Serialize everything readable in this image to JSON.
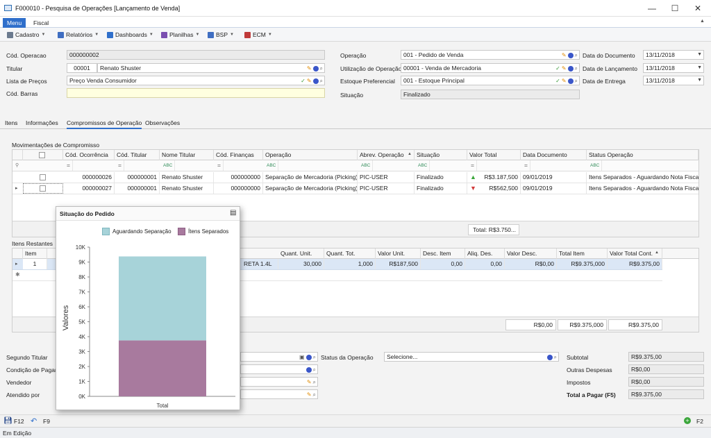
{
  "window": {
    "title": "F000010 - Pesquisa de Operações [Lançamento de Venda]",
    "min": "—",
    "max": "☐",
    "close": "✕"
  },
  "tabs": [
    "Menu",
    "Fiscal"
  ],
  "toolbar": [
    {
      "label": "Cadastro",
      "color": "#6b7a8f"
    },
    {
      "label": "Relatórios",
      "color": "#3f6ec2"
    },
    {
      "label": "Dashboards",
      "color": "#2f6fcb"
    },
    {
      "label": "Planilhas",
      "color": "#7a4fb0"
    },
    {
      "label": "BSP",
      "color": "#3f6ec2"
    },
    {
      "label": "ECM",
      "color": "#c03a3a"
    }
  ],
  "form": {
    "cod_operacao_label": "Cód. Operacao",
    "cod_operacao": "000000002",
    "titular_label": "Titular",
    "titular_code": "00001",
    "titular_name": "Renato Shuster",
    "lista_label": "Lista de Preços",
    "lista": "Preço Venda Consumidor",
    "barras_label": "Cód. Barras",
    "barras": "",
    "operacao_label": "Operação",
    "operacao": "001 - Pedido de Venda",
    "utilizacao_label": "Utilização de Operação",
    "utilizacao": "00001 - Venda de Mercadoria",
    "estoque_label": "Estoque Preferencial",
    "estoque": "001 - Estoque Principal",
    "situacao_label": "Situação",
    "situacao": "Finalizado",
    "data_doc_label": "Data do Documento",
    "data_doc": "13/11/2018",
    "data_lanc_label": "Data de Lançamento",
    "data_lanc": "13/11/2018",
    "data_ent_label": "Data de Entrega",
    "data_ent": "13/11/2018"
  },
  "subtabs": [
    "Itens",
    "Informações",
    "Compromissos de Operação",
    "Observações"
  ],
  "mov": {
    "title": "Movimentações de Compromisso",
    "headers": [
      "Cód. Ocorrência",
      "Cód. Titular",
      "Nome Titular",
      "Cód. Finanças",
      "Operação",
      "Abrev. Operação",
      "Situação",
      "Valor Total",
      "Data Documento",
      "Status Operação"
    ],
    "filters": [
      "=",
      "=",
      "ABC",
      "=",
      "ABC",
      "ABC",
      "ABC",
      "=",
      "=",
      "ABC"
    ],
    "rows": [
      [
        "000000026",
        "000000001",
        "Renato Shuster",
        "000000000",
        "Separação de Mercadoria (Picking)",
        "PIC-USER",
        "Finalizado",
        "R$3.187,500",
        "09/01/2019",
        "Itens Separados - Aguardando Nota Fiscal"
      ],
      [
        "000000027",
        "000000001",
        "Renato Shuster",
        "000000000",
        "Separação de Mercadoria (Picking)",
        "PIC-USER",
        "Finalizado",
        "R$562,500",
        "09/01/2019",
        "Itens Separados - Aguardando Nota Fiscal"
      ]
    ],
    "total": "Total: R$3.750..."
  },
  "itens": {
    "title": "Itens Restantes",
    "headers": [
      "Item",
      "Quant. Unit.",
      "Quant. Tot.",
      "Valor Unit.",
      "Desc. Item",
      "Aliq. Des.",
      "Valor Desc.",
      "Total Item",
      "Valor Total Cont."
    ],
    "row": [
      "1",
      "RETA 1.4L",
      "30,000",
      "1,000",
      "R$187,500",
      "0,00",
      "0,00",
      "R$0,00",
      "R$9.375,000",
      "R$9.375,00"
    ],
    "footer": [
      "R$0,00",
      "R$9.375,000",
      "R$9.375,00"
    ]
  },
  "bottom": {
    "segundo": "Segundo Titular",
    "condicao": "Condição de Pagam",
    "vendedor": "Vendedor",
    "atendido": "Atendido por",
    "status_label": "Status da Operação",
    "status_value": "Selecione...",
    "subtotal_label": "Subtotal",
    "subtotal": "R$9.375,00",
    "outras_label": "Outras Despesas",
    "outras": "R$0,00",
    "impostos_label": "Impostos",
    "impostos": "R$0,00",
    "total_label": "Total a Pagar (F5)",
    "total": "R$9.375,00"
  },
  "actions": {
    "f12": "F12",
    "f9": "F9",
    "f2": "F2"
  },
  "status": "Em Edição",
  "chart_data": {
    "type": "bar",
    "title": "Situação do Pedido",
    "categories": [
      "Total"
    ],
    "series": [
      {
        "name": "Itens Separados",
        "values": [
          3750
        ],
        "color": "#a87a9e"
      },
      {
        "name": "Aguardando Separação",
        "values": [
          5625
        ],
        "color": "#a7d3d9"
      }
    ],
    "legend": [
      "Aguardando Separação",
      "Ítens Separados"
    ],
    "ylabel": "Valores",
    "ylim": [
      0,
      10000
    ],
    "yticks": [
      "0K",
      "1K",
      "2K",
      "3K",
      "4K",
      "5K",
      "6K",
      "7K",
      "8K",
      "9K",
      "10K"
    ],
    "stacked": true,
    "legend_position": "top-right"
  }
}
